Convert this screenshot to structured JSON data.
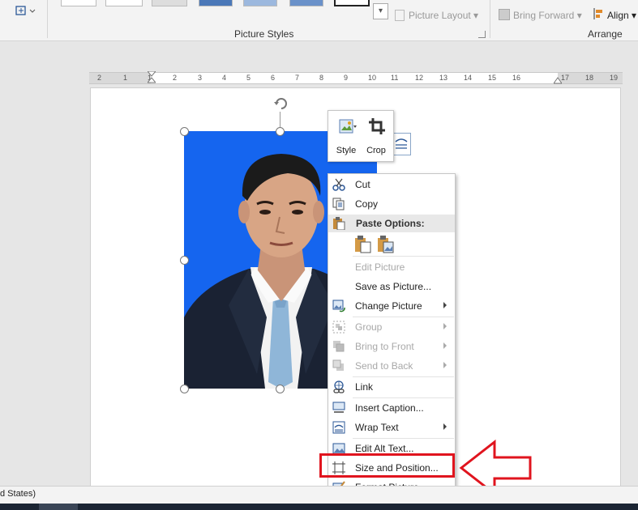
{
  "ribbon": {
    "group_picture_styles": "Picture Styles",
    "picture_layout": "Picture Layout",
    "bring_forward": "Bring Forward",
    "align": "Align",
    "group_arrange": "Arrange"
  },
  "ruler": {
    "numbers": [
      "2",
      "1",
      "1",
      "2",
      "3",
      "4",
      "5",
      "6",
      "7",
      "8",
      "9",
      "10",
      "11",
      "12",
      "13",
      "14",
      "15",
      "16",
      "17",
      "18",
      "19"
    ]
  },
  "mini_toolbar": {
    "style_label": "Style",
    "crop_label": "Crop"
  },
  "context_menu": {
    "cut": "Cut",
    "copy": "Copy",
    "paste_options": "Paste Options:",
    "edit_picture": "Edit Picture",
    "save_as_picture": "Save as Picture...",
    "change_picture": "Change Picture",
    "group": "Group",
    "bring_to_front": "Bring to Front",
    "send_to_back": "Send to Back",
    "link": "Link",
    "insert_caption": "Insert Caption...",
    "wrap_text": "Wrap Text",
    "edit_alt_text": "Edit Alt Text...",
    "size_and_position": "Size and Position...",
    "format_picture": "Format Picture..."
  },
  "status_bar": {
    "text": "d States)"
  },
  "colors": {
    "photo_background": "#1565ef",
    "annotation_red": "#e0141e"
  }
}
